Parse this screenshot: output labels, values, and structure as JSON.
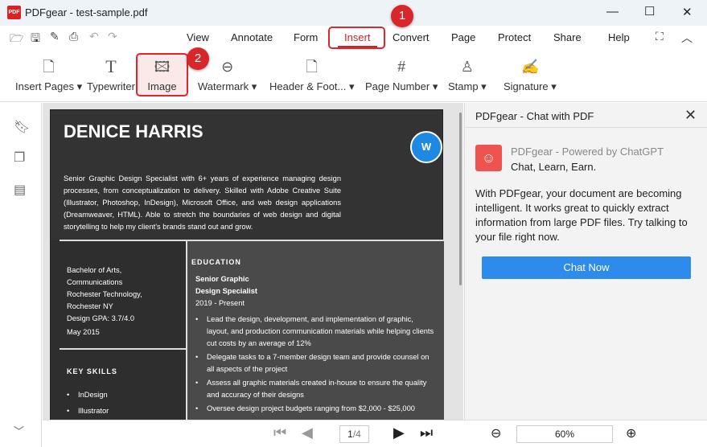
{
  "window": {
    "title": "PDFgear - test-sample.pdf",
    "app_icon": "pdfgear-logo"
  },
  "menu_tabs": [
    "View",
    "Annotate",
    "Form",
    "Insert",
    "Convert",
    "Page",
    "Protect",
    "Share",
    "Help"
  ],
  "active_tab": "Insert",
  "tools": [
    {
      "label": "Insert Pages ▾",
      "icon": "insert-page-icon"
    },
    {
      "label": "Typewriter",
      "icon": "typewriter-icon"
    },
    {
      "label": "Image",
      "icon": "image-icon"
    },
    {
      "label": "Watermark ▾",
      "icon": "watermark-icon"
    },
    {
      "label": "Header & Foot... ▾",
      "icon": "header-footer-icon"
    },
    {
      "label": "Page Number ▾",
      "icon": "page-number-icon"
    },
    {
      "label": "Stamp ▾",
      "icon": "stamp-icon"
    },
    {
      "label": "Signature ▾",
      "icon": "signature-icon"
    }
  ],
  "annotations": {
    "step1": "1",
    "step2": "2",
    "highlight_color": "#e0262b"
  },
  "document": {
    "name": "DENICE HARRIS",
    "convert_button": "W",
    "summary": "Senior Graphic Design Specialist with 6+ years of experience managing design processes, from conceptualization to delivery. Skilled with Adobe Creative Suite (Illustrator, Photoshop, InDesign), Microsoft Office, and web design applications (Dreamweaver, HTML). Able to stretch the boundaries of web design and digital storytelling to help my client's brands stand out and grow.",
    "degree": [
      "Bachelor of Arts,",
      "Communications",
      "Rochester Technology,",
      "Rochester NY",
      "Design GPA: 3.7/4.0",
      "May 2015"
    ],
    "key_skills_heading": "KEY SKILLS",
    "skills": [
      "InDesign",
      "Illustrator"
    ],
    "education_heading": "EDUCATION",
    "job_title": "Senior Graphic Design Specialist",
    "job_dates": "2019 - Present",
    "bullets": [
      "Lead the design, development, and implementation of graphic, layout, and production communication materials while helping clients cut costs by an average of 12%",
      "Delegate tasks to a 7-member design team and provide counsel on all aspects of the project",
      "Assess all graphic materials created in-house to ensure the quality and accuracy of their designs",
      "Oversee design project budgets ranging from $2,000 - $25,000"
    ]
  },
  "chat": {
    "title": "PDFgear - Chat with PDF",
    "powered": "PDFgear - Powered by ChatGPT",
    "tagline": "Chat, Learn, Earn.",
    "body": "With PDFgear, your document are becoming intelligent. It works great to quickly extract information from large PDF files. Try talking to your file right now.",
    "button": "Chat Now"
  },
  "footer": {
    "page": "1",
    "total": "/4",
    "zoom": "60%"
  }
}
